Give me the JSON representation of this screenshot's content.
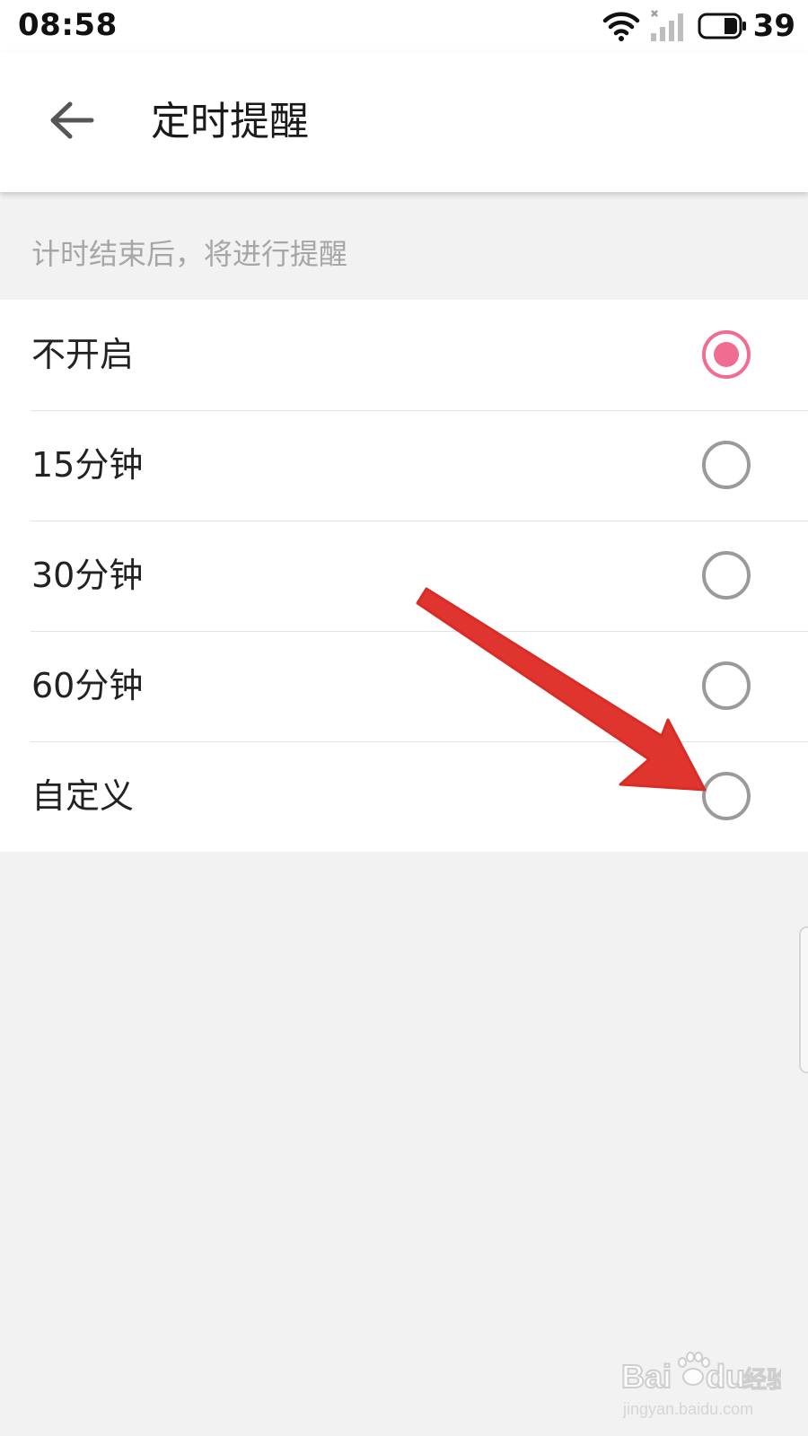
{
  "status_bar": {
    "time": "08:58",
    "battery_percent": "39",
    "icons": [
      "wifi-icon",
      "signal-icon",
      "battery-icon"
    ]
  },
  "header": {
    "back_icon": "arrow-left-icon",
    "title": "定时提醒"
  },
  "hint": "计时结束后，将进行提醒",
  "options": [
    {
      "label": "不开启",
      "selected": true
    },
    {
      "label": "15分钟",
      "selected": false
    },
    {
      "label": "30分钟",
      "selected": false
    },
    {
      "label": "60分钟",
      "selected": false
    },
    {
      "label": "自定义",
      "selected": false
    }
  ],
  "colors": {
    "accent": "#f06c91",
    "radio_off": "#9a9a9a",
    "background": "#f2f2f2",
    "annotation": "#e0352f"
  }
}
